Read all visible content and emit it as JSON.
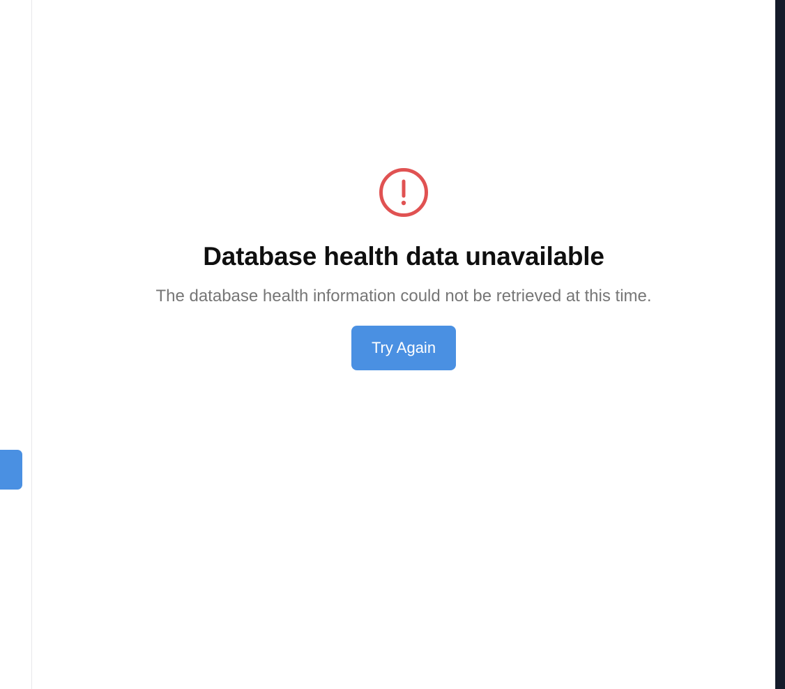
{
  "error_state": {
    "icon": "alert-circle-icon",
    "icon_color": "#e05252",
    "title": "Database health data unavailable",
    "message": "The database health information could not be retrieved at this time.",
    "retry_button_label": "Try Again"
  },
  "colors": {
    "accent": "#4a90e2",
    "background": "#ffffff",
    "right_edge": "#151b2a",
    "title_text": "#0f0f0f",
    "message_text": "#767676"
  }
}
